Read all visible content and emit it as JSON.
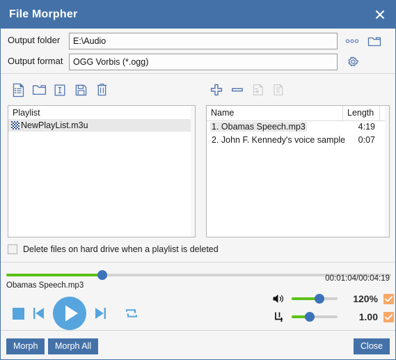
{
  "window": {
    "title": "File Morpher",
    "close_icon": "close-x-icon"
  },
  "form": {
    "output_folder": {
      "label": "Output folder",
      "value": "E:\\Audio",
      "placeholder": "",
      "browse_dots_icon": "ellipsis-icon",
      "browse_folder_icon": "folder-icon"
    },
    "output_format": {
      "label": "Output format",
      "value": "OGG Vorbis (*.ogg)",
      "placeholder": "",
      "settings_icon": "gear-icon"
    }
  },
  "playlist_panel": {
    "toolbar": [
      {
        "name": "new-playlist-icon",
        "title": "New playlist",
        "disabled": false
      },
      {
        "name": "open-playlist-icon",
        "title": "Open playlist",
        "disabled": false
      },
      {
        "name": "rename-playlist-icon",
        "title": "Rename playlist",
        "disabled": false
      },
      {
        "name": "save-playlist-icon",
        "title": "Save playlist",
        "disabled": false
      },
      {
        "name": "delete-playlist-icon",
        "title": "Delete playlist",
        "disabled": false
      }
    ],
    "header": "Playlist",
    "items": [
      {
        "label": "NewPlayList.m3u",
        "selected": true
      }
    ]
  },
  "tracks_panel": {
    "toolbar": [
      {
        "name": "add-file-icon",
        "title": "Add file",
        "disabled": false
      },
      {
        "name": "remove-file-icon",
        "title": "Remove file",
        "disabled": false
      },
      {
        "name": "move-file-icon",
        "title": "Move file",
        "disabled": true
      },
      {
        "name": "copy-file-icon",
        "title": "Copy file",
        "disabled": true
      }
    ],
    "columns": [
      "Name",
      "Length"
    ],
    "rows": [
      {
        "name": "1. Obamas Speech.mp3",
        "length": "4:19",
        "selected": true
      },
      {
        "name": "2. John F. Kennedy's voice sample",
        "length": "0:07",
        "selected": false
      }
    ]
  },
  "options": {
    "delete_files_label": "Delete files on hard drive when a playlist is deleted",
    "delete_files_checked": false
  },
  "player": {
    "seek_percent": 25,
    "now_playing": "Obamas Speech.mp3",
    "time_display": "00:01:04/00:04:19",
    "transport": {
      "stop_icon": "stop-icon",
      "prev_icon": "previous-track-icon",
      "play_icon": "play-icon",
      "next_icon": "next-track-icon",
      "repeat_icon": "repeat-icon"
    },
    "volume": {
      "icon": "speaker-volume-icon",
      "value": "120%",
      "percent": 60,
      "enabled": true,
      "check_icon": "checkmark-icon"
    },
    "speed": {
      "icon": "tempo-icon",
      "value": "1.00",
      "percent": 40,
      "enabled": true,
      "check_icon": "checkmark-icon",
      "reset_icon": "reset-icon"
    }
  },
  "footer": {
    "morph_label": "Morph",
    "morph_all_label": "Morph All",
    "close_label": "Close"
  },
  "colors": {
    "titlebar": "#4472a8",
    "accent_button": "#4472a8",
    "slider_fill": "#5cc11a",
    "slider_thumb": "#3d72ba",
    "transport": "#56a5de",
    "check_on": "#f8a96a"
  }
}
